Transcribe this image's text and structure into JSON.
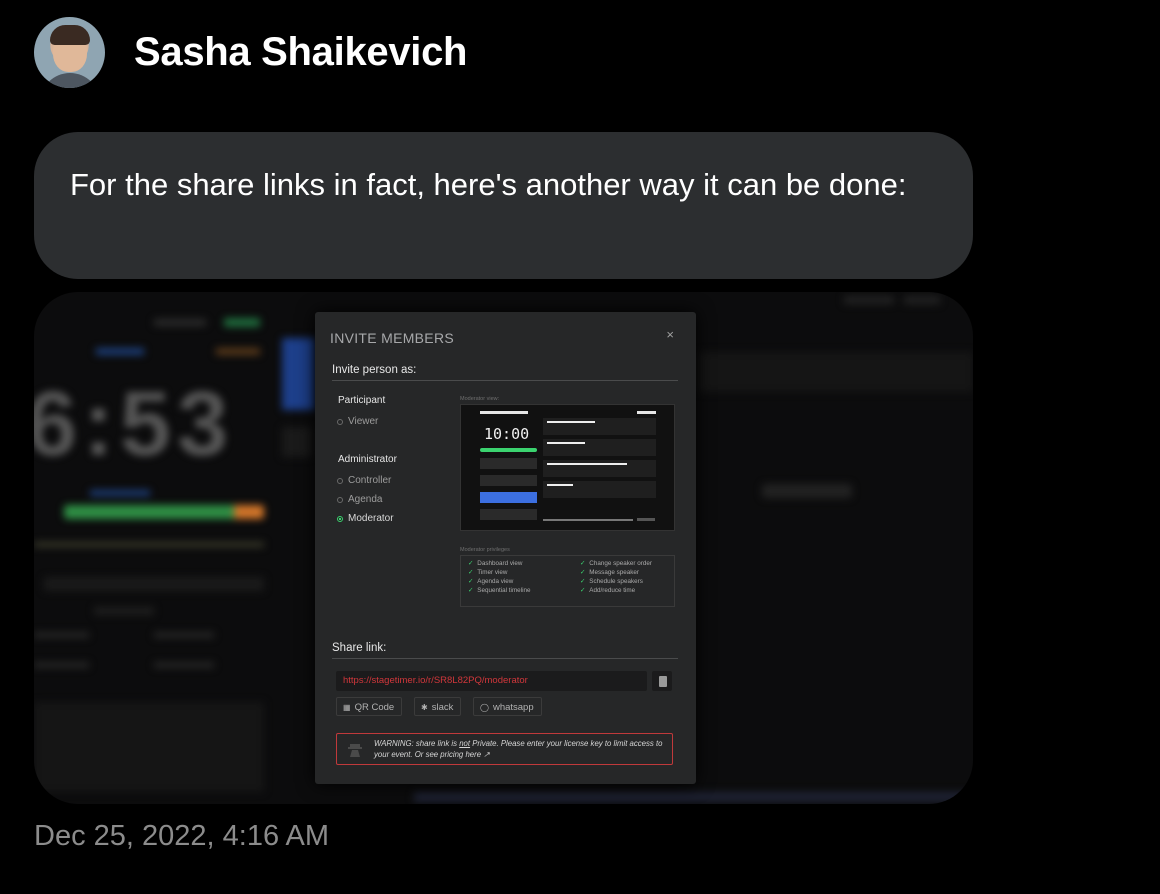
{
  "message": {
    "sender_name": "Sasha Shaikevich",
    "avatar_icon": "person-avatar",
    "text": "For the share links in fact, here's another way it can be done:",
    "timestamp": "Dec 25, 2022, 4:16 AM"
  },
  "screenshot": {
    "background_clock": "6:53",
    "modal": {
      "title": "INVITE MEMBERS",
      "close_icon": "×",
      "invite_heading": "Invite person as:",
      "participant_group": "Participant",
      "participant_options": [
        "Viewer"
      ],
      "administrator_group": "Administrator",
      "administrator_options": [
        "Controller",
        "Agenda",
        "Moderator"
      ],
      "selected_role": "Moderator",
      "preview_label": "Moderator view:",
      "preview_timer": "10:00",
      "privileges_label": "Moderator privileges",
      "privileges_left": [
        "Dashboard view",
        "Timer view",
        "Agenda view",
        "Sequential timeline"
      ],
      "privileges_right": [
        "Change speaker order",
        "Message speaker",
        "Schedule speakers",
        "Add/reduce time"
      ],
      "share_heading": "Share link:",
      "share_url": "https://stagetimer.io/r/SR8L82PQ/moderator",
      "share_buttons": [
        "QR Code",
        "slack",
        "whatsapp"
      ],
      "warning_prefix": "WARNING: share link is ",
      "warning_emph": "not",
      "warning_rest": " Private. Please enter your license key to limit access to your event. Or see pricing here",
      "accent_color": "#3bd36f",
      "url_color": "#d1373b",
      "warning_border_color": "#c0393b"
    }
  }
}
